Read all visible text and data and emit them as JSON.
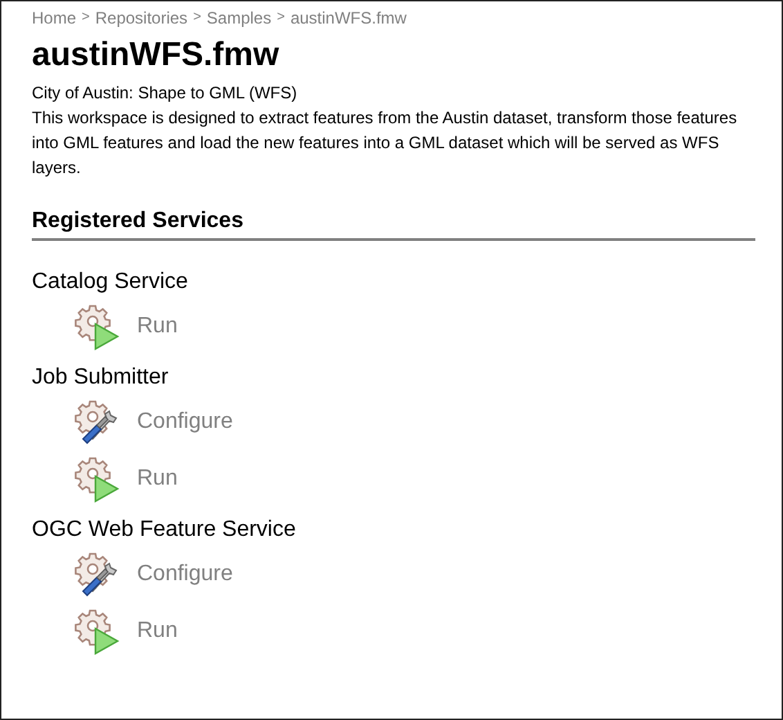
{
  "breadcrumb": [
    "Home",
    "Repositories",
    "Samples",
    "austinWFS.fmw"
  ],
  "breadcrumb_separator": ">",
  "title": "austinWFS.fmw",
  "subtitle": "City of Austin: Shape to GML (WFS)",
  "description": "This workspace is designed to extract features from the Austin dataset, transform those features into GML features and load the new features into a GML dataset which will be served as WFS layers.",
  "section_heading": "Registered Services",
  "services": [
    {
      "name": "Catalog Service",
      "actions": [
        {
          "kind": "run",
          "label": "Run"
        }
      ]
    },
    {
      "name": "Job Submitter",
      "actions": [
        {
          "kind": "configure",
          "label": "Configure"
        },
        {
          "kind": "run",
          "label": "Run"
        }
      ]
    },
    {
      "name": "OGC Web Feature Service",
      "actions": [
        {
          "kind": "configure",
          "label": "Configure"
        },
        {
          "kind": "run",
          "label": "Run"
        }
      ]
    }
  ]
}
